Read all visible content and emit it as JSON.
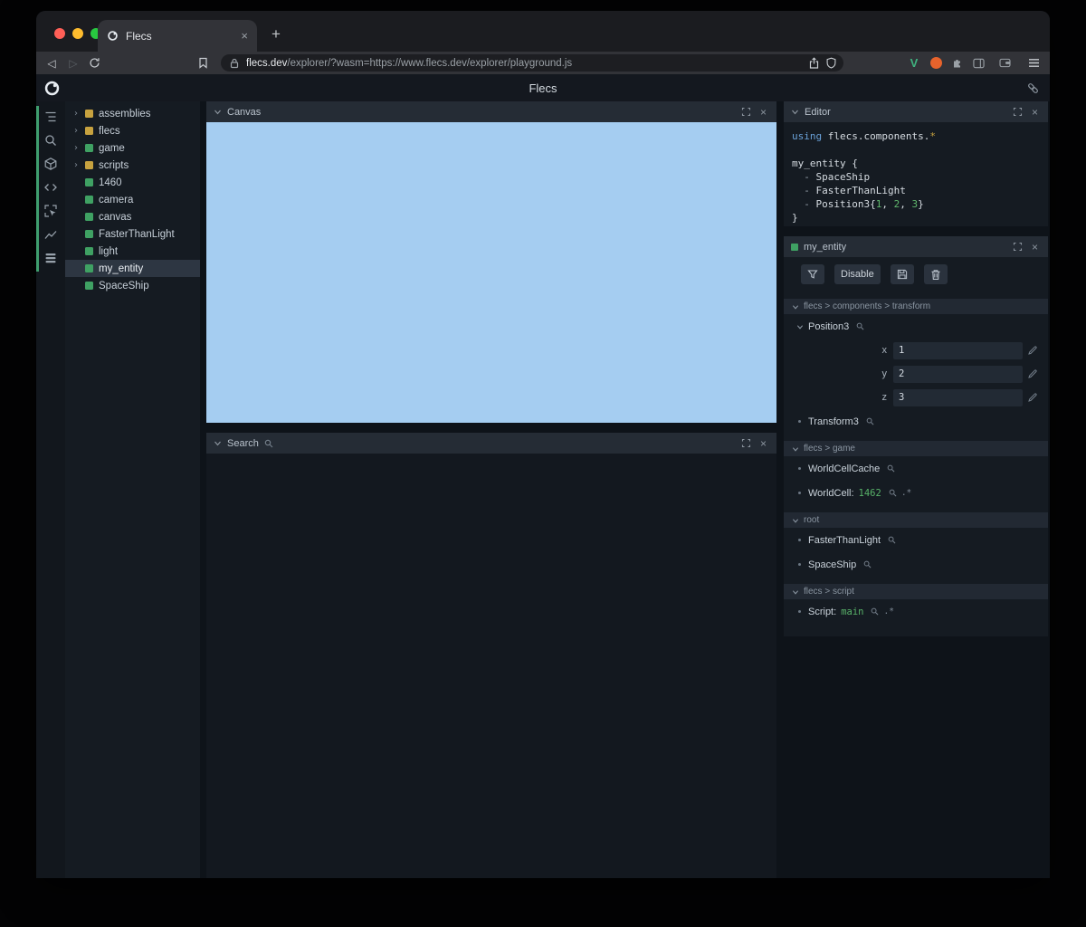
{
  "icons": {
    "back": "◁",
    "forward": "▷",
    "new_tab": "+",
    "close": "×",
    "expander": "›",
    "brave_v": "V"
  },
  "browser": {
    "tab": {
      "title": "Flecs"
    },
    "url": {
      "domain": "flecs.dev",
      "path": "/explorer/?wasm=https://www.flecs.dev/explorer/playground.js"
    }
  },
  "app": {
    "header": {
      "title": "Flecs"
    }
  },
  "tree": {
    "items": [
      {
        "label": "assemblies",
        "color": "yellow",
        "expandable": true,
        "selected": false
      },
      {
        "label": "flecs",
        "color": "yellow",
        "expandable": true,
        "selected": false
      },
      {
        "label": "game",
        "color": "green",
        "expandable": true,
        "selected": false
      },
      {
        "label": "scripts",
        "color": "yellow",
        "expandable": true,
        "selected": false
      },
      {
        "label": "1460",
        "color": "green",
        "expandable": false,
        "selected": false
      },
      {
        "label": "camera",
        "color": "green",
        "expandable": false,
        "selected": false
      },
      {
        "label": "canvas",
        "color": "green",
        "expandable": false,
        "selected": false
      },
      {
        "label": "FasterThanLight",
        "color": "green",
        "expandable": false,
        "selected": false
      },
      {
        "label": "light",
        "color": "green",
        "expandable": false,
        "selected": false
      },
      {
        "label": "my_entity",
        "color": "green",
        "expandable": false,
        "selected": true
      },
      {
        "label": "SpaceShip",
        "color": "green",
        "expandable": false,
        "selected": false
      }
    ]
  },
  "panels": {
    "canvas": {
      "title": "Canvas"
    },
    "search": {
      "title": "Search"
    },
    "editor": {
      "title": "Editor",
      "code": [
        [
          {
            "t": "using ",
            "c": "kw"
          },
          {
            "t": "flecs.components.",
            "c": "p"
          },
          {
            "t": "*",
            "c": "op"
          }
        ],
        [],
        [
          {
            "t": "my_entity {",
            "c": "p"
          }
        ],
        [
          {
            "t": "  - ",
            "c": "dim"
          },
          {
            "t": "SpaceShip",
            "c": "p"
          }
        ],
        [
          {
            "t": "  - ",
            "c": "dim"
          },
          {
            "t": "FasterThanLight",
            "c": "p"
          }
        ],
        [
          {
            "t": "  - ",
            "c": "dim"
          },
          {
            "t": "Position3{",
            "c": "p"
          },
          {
            "t": "1",
            "c": "num"
          },
          {
            "t": ", ",
            "c": "p"
          },
          {
            "t": "2",
            "c": "num"
          },
          {
            "t": ", ",
            "c": "p"
          },
          {
            "t": "3",
            "c": "num"
          },
          {
            "t": "}",
            "c": "p"
          }
        ],
        [
          {
            "t": "}",
            "c": "p"
          }
        ]
      ]
    },
    "inspector": {
      "title": "my_entity",
      "toolbar": {
        "disable_label": "Disable"
      },
      "sections": [
        {
          "path": "flecs > components > transform",
          "items": [
            {
              "name": "Position3",
              "expanded": true,
              "fields": [
                {
                  "label": "x",
                  "value": "1"
                },
                {
                  "label": "y",
                  "value": "2"
                },
                {
                  "label": "z",
                  "value": "3"
                }
              ]
            },
            {
              "name": "Transform3"
            }
          ]
        },
        {
          "path": "flecs > game",
          "items": [
            {
              "name": "WorldCellCache"
            },
            {
              "name": "WorldCell",
              "value": "1462",
              "inherited": true
            }
          ]
        },
        {
          "path": "root",
          "items": [
            {
              "name": "FasterThanLight"
            },
            {
              "name": "SpaceShip"
            }
          ]
        },
        {
          "path": "flecs > script",
          "items": [
            {
              "name": "Script",
              "value": "main",
              "inherited": true
            }
          ]
        }
      ]
    }
  },
  "colors": {
    "accent_green": "#3f9e6e",
    "entity_green": "#3fa163",
    "module_yellow": "#c7a23f",
    "canvas_blue": "#a5cdf1",
    "value_green": "#58b269"
  }
}
